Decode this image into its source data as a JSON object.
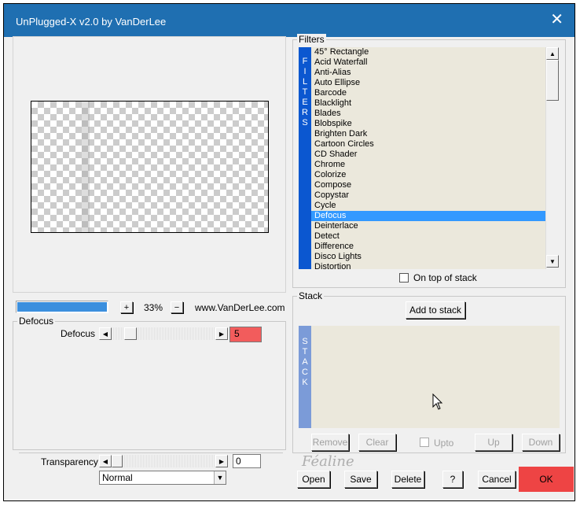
{
  "window": {
    "title": "UnPlugged-X v2.0 by VanDerLee",
    "close_glyph": "✕"
  },
  "preview": {
    "zoom": "33%",
    "plus": "+",
    "minus": "−",
    "website": "www.VanDerLee.com"
  },
  "params": {
    "group_label": "Defocus",
    "slider_label": "Defocus",
    "slider_value": "5",
    "slider_fraction": 0.05,
    "transparency_label": "Transparency",
    "transparency_value": "0",
    "blend_mode": "Normal"
  },
  "filters": {
    "group_label": "Filters",
    "band_letters": [
      "F",
      "I",
      "L",
      "T",
      "E",
      "R",
      "S"
    ],
    "items": [
      "45° Rectangle",
      "Acid Waterfall",
      "Anti-Alias",
      "Auto Ellipse",
      "Barcode",
      "Blacklight",
      "Blades",
      "Blobspike",
      "Brighten Dark",
      "Cartoon Circles",
      "CD Shader",
      "Chrome",
      "Colorize",
      "Compose",
      "Copystar",
      "Cycle",
      "Defocus",
      "Deinterlace",
      "Detect",
      "Difference",
      "Disco Lights",
      "Distortion"
    ],
    "selected_index": 16,
    "on_top_label": "On top of stack"
  },
  "stack": {
    "group_label": "Stack",
    "add_label": "Add to stack",
    "band_letters": [
      "S",
      "T",
      "A",
      "C",
      "K"
    ],
    "remove_label": "Remove",
    "clear_label": "Clear",
    "upto_label": "Upto",
    "up_label": "Up",
    "down_label": "Down"
  },
  "footer": {
    "open_label": "Open",
    "save_label": "Save",
    "delete_label": "Delete",
    "help_label": "?",
    "cancel_label": "Cancel",
    "ok_label": "OK",
    "watermark": "Féaline"
  },
  "colors": {
    "titlebar": "#1f6fb1",
    "filters_band": "#0b57d0",
    "stack_band": "#7b9bd8",
    "selection": "#3399ff",
    "list_bg": "#ebe8dc",
    "value_box": "#f25c5c",
    "ok_button": "#ee4444",
    "progress": "#3b8fde"
  }
}
